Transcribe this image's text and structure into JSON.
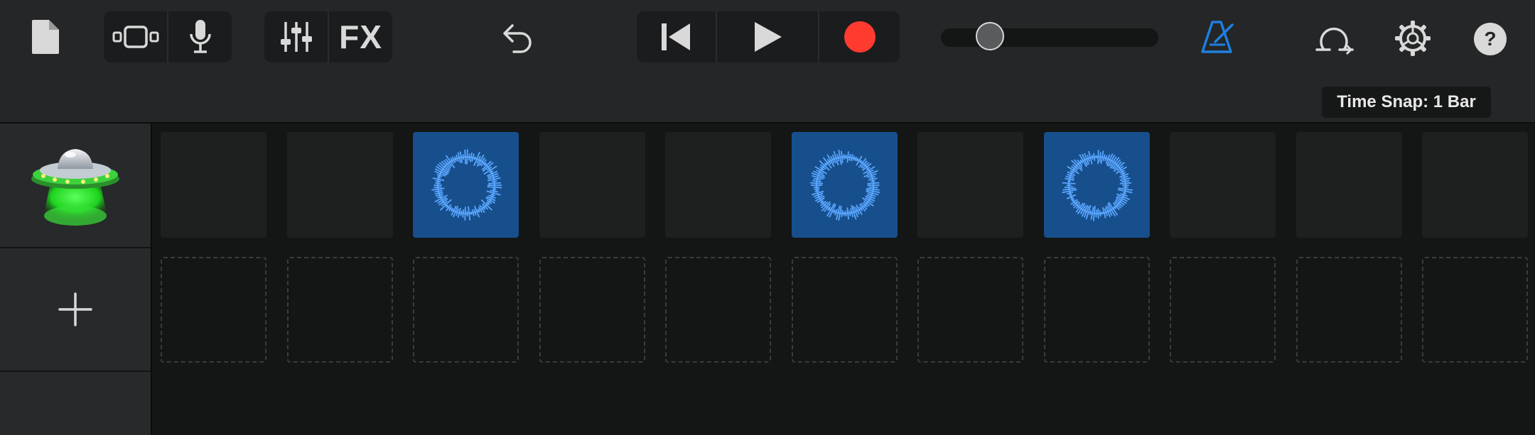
{
  "toolbar": {
    "buttons": [
      {
        "name": "my-songs",
        "icon": "document-icon"
      },
      {
        "name": "browser-view",
        "icon": "view-switch-icon"
      },
      {
        "name": "microphone",
        "icon": "microphone-icon"
      },
      {
        "name": "mixer",
        "icon": "sliders-icon"
      },
      {
        "name": "fx",
        "label": "FX"
      },
      {
        "name": "undo",
        "icon": "undo-icon"
      },
      {
        "name": "go-to-start",
        "icon": "skip-back-icon"
      },
      {
        "name": "play",
        "icon": "play-icon"
      },
      {
        "name": "record",
        "icon": "record-icon"
      },
      {
        "name": "metronome",
        "icon": "metronome-icon"
      },
      {
        "name": "loop-browser",
        "icon": "loop-icon"
      },
      {
        "name": "settings",
        "icon": "gear-icon"
      },
      {
        "name": "help",
        "icon": "help-icon"
      }
    ],
    "fx_label": "FX",
    "volume_level": 0.14,
    "colors": {
      "accent": "#1e7fe0",
      "record": "#ff3b30",
      "loop_cell": "#174f8c",
      "waveform": "#5aa6ff"
    }
  },
  "subbar": {
    "time_snap_label": "Time Snap: 1 Bar"
  },
  "tracks": [
    {
      "name": "UFO",
      "icon": "ufo-icon"
    },
    {
      "name": "add-track",
      "icon": "plus-icon"
    }
  ],
  "grid": {
    "row1": [
      "empty",
      "empty",
      "loop",
      "empty",
      "empty",
      "loop",
      "empty",
      "loop",
      "empty",
      "empty",
      "empty"
    ],
    "row2": [
      "slot",
      "slot",
      "slot",
      "slot",
      "slot",
      "slot",
      "slot",
      "slot",
      "slot",
      "slot",
      "slot"
    ]
  }
}
